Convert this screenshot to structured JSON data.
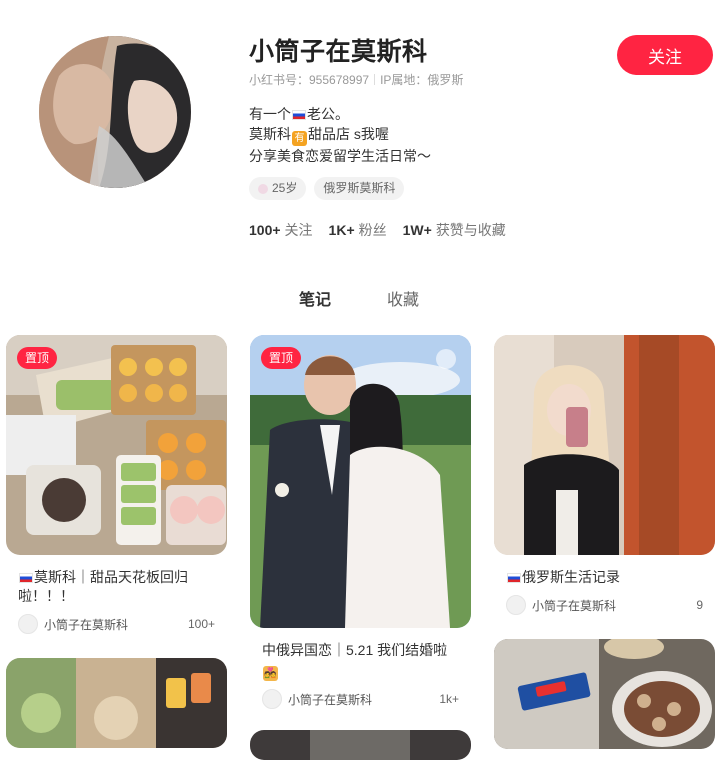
{
  "profile": {
    "name": "小筒子在莫斯科",
    "red_id": "小红书号：955678997",
    "ip_location": "IP属地：俄罗斯",
    "follow_label": "关注",
    "bio": [
      "有一个",
      "老公。",
      "莫斯科",
      "甜品店 s我喔",
      "分享美食恋爱留学生活日常～"
    ],
    "tags": [
      "25岁",
      "俄罗斯莫斯科"
    ],
    "stats": [
      {
        "num": "100+",
        "label": "关注"
      },
      {
        "num": "1K+",
        "label": "粉丝"
      },
      {
        "num": "1W+",
        "label": "获赞与收藏"
      }
    ]
  },
  "tabs": {
    "notes": "笔记",
    "collections": "收藏"
  },
  "pinned_label": "置顶",
  "notes": [
    {
      "title_a": "莫斯科｜甜品天花板回归",
      "title_b": "啦！！！",
      "author": "小筒子在莫斯科",
      "likes": "100+"
    },
    {
      "title_a": "中俄异国恋｜5.21 我们结婚啦",
      "author": "小筒子在莫斯科",
      "likes": "1k+"
    },
    {
      "title_a": "俄罗斯生活记录",
      "author": "小筒子在莫斯科",
      "likes": "9"
    }
  ],
  "colors": {
    "accent": "#ff2442",
    "muted": "#999999"
  },
  "icons": {
    "like": "heart-icon",
    "flag": "russia-flag-icon"
  }
}
